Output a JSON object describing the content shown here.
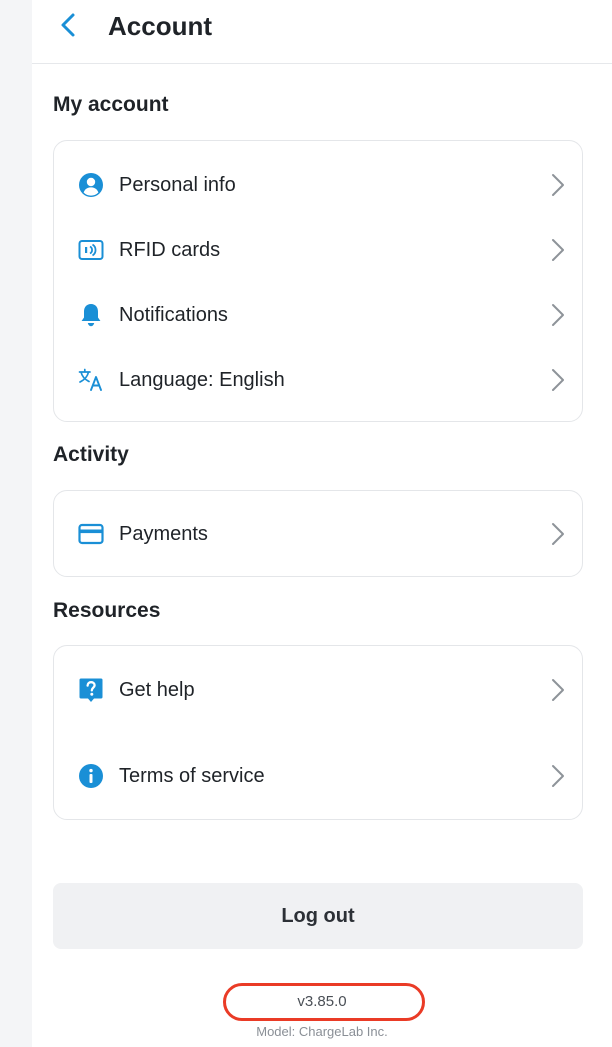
{
  "header": {
    "back_icon": "chevron-left-icon",
    "title": "Account"
  },
  "colors": {
    "accent": "#1a8fd6",
    "chevron": "#8e9399",
    "highlight_ring": "#ea3b26"
  },
  "sections": [
    {
      "title": "My account",
      "items": [
        {
          "icon": "user-circle-icon",
          "label": "Personal info"
        },
        {
          "icon": "rfid-card-icon",
          "label": "RFID cards"
        },
        {
          "icon": "bell-icon",
          "label": "Notifications"
        },
        {
          "icon": "translate-icon",
          "label": "Language: English"
        }
      ]
    },
    {
      "title": "Activity",
      "items": [
        {
          "icon": "credit-card-icon",
          "label": "Payments"
        }
      ]
    },
    {
      "title": "Resources",
      "items": [
        {
          "icon": "help-icon",
          "label": "Get help"
        },
        {
          "icon": "info-icon",
          "label": "Terms of service"
        }
      ]
    }
  ],
  "logout": {
    "label": "Log out"
  },
  "footer": {
    "version": "v3.85.0",
    "model": "Model: ChargeLab Inc."
  }
}
